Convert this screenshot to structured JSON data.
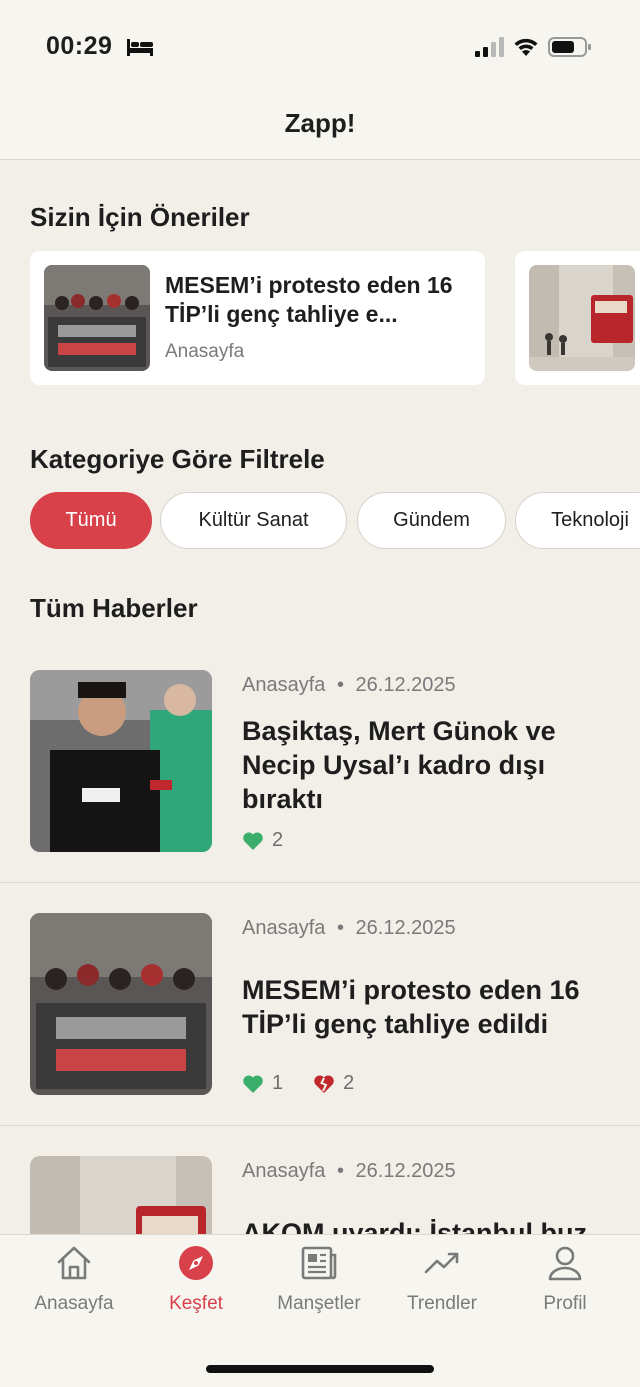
{
  "status_bar": {
    "time": "00:29"
  },
  "header": {
    "title": "Zapp!"
  },
  "recommendations": {
    "title": "Sizin İçin Öneriler",
    "items": [
      {
        "title": "MESEM’i protesto eden 16 TİP’li genç tahliye e...",
        "source": "Anasayfa"
      },
      {
        "title": "",
        "source": ""
      }
    ]
  },
  "filter": {
    "title": "Kategoriye Göre Filtrele",
    "chips": [
      "Tümü",
      "Kültür Sanat",
      "Gündem",
      "Teknoloji"
    ],
    "selected": "Tümü"
  },
  "news": {
    "title": "Tüm Haberler",
    "items": [
      {
        "source": "Anasayfa",
        "separator": "•",
        "date": "26.12.2025",
        "title": "Başiktaş, Mert Günok ve Necip Uysal’ı kadro dışı bıraktı",
        "likes": "2"
      },
      {
        "source": "Anasayfa",
        "separator": "•",
        "date": "26.12.2025",
        "title": "MESEM’i protesto eden 16 TİP’li genç tahliye edildi",
        "likes": "1",
        "dislikes": "2"
      },
      {
        "source": "Anasayfa",
        "separator": "•",
        "date": "26.12.2025",
        "title": "AKOM uyardı: İstanbul buz"
      }
    ]
  },
  "tab_bar": {
    "tabs": [
      {
        "label": "Anasayfa",
        "icon": "home-icon"
      },
      {
        "label": "Keşfet",
        "icon": "compass-icon"
      },
      {
        "label": "Manşetler",
        "icon": "newspaper-icon"
      },
      {
        "label": "Trendler",
        "icon": "trending-icon"
      },
      {
        "label": "Profil",
        "icon": "profile-icon"
      }
    ],
    "active": "Keşfet"
  },
  "colors": {
    "accent": "#d8404a",
    "like": "#3aae6a",
    "background": "#f2efe9",
    "card": "#ffffff"
  }
}
